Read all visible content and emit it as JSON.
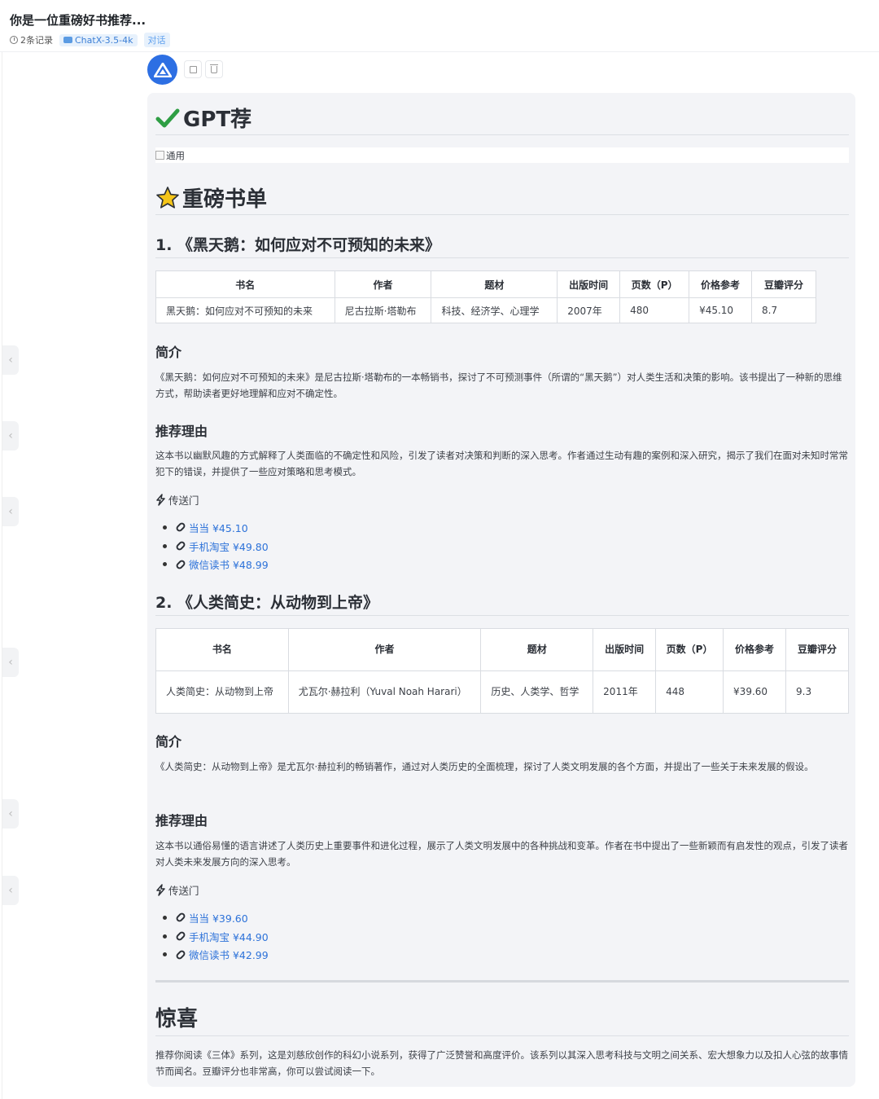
{
  "header": {
    "title": "你是一位重磅好书推荐...",
    "records": "2条记录",
    "model": "ChatX-3.5-4k",
    "type": "对话"
  },
  "message": {
    "heading_gpt": "GPT荐",
    "banner_alt": "通用",
    "heading_list": "重磅书单",
    "books": [
      {
        "title": "1. 《黑天鹅：如何应对不可预知的未来》",
        "table_headers": [
          "书名",
          "作者",
          "题材",
          "出版时间",
          "页数（P）",
          "价格参考",
          "豆瓣评分"
        ],
        "table_row": [
          "黑天鹅：如何应对不可预知的未来",
          "尼古拉斯·塔勒布",
          "科技、经济学、心理学",
          "2007年",
          "480",
          "¥45.10",
          "8.7"
        ],
        "intro_heading": "简介",
        "intro": "《黑天鹅：如何应对不可预知的未来》是尼古拉斯·塔勒布的一本畅销书，探讨了不可预测事件（所谓的“黑天鹅”）对人类生活和决策的影响。该书提出了一种新的思维方式，帮助读者更好地理解和应对不确定性。",
        "reason_heading": "推荐理由",
        "reason": "这本书以幽默风趣的方式解释了人类面临的不确定性和风险，引发了读者对决策和判断的深入思考。作者通过生动有趣的案例和深入研究，揭示了我们在面对未知时常常犯下的错误，并提供了一些应对策略和思考模式。",
        "portal": "传送门",
        "links": [
          "当当 ¥45.10",
          "手机淘宝 ¥49.80",
          "微信读书 ¥48.99"
        ]
      },
      {
        "title": "2. 《人类简史：从动物到上帝》",
        "table_headers": [
          "书名",
          "作者",
          "题材",
          "出版时间",
          "页数（P）",
          "价格参考",
          "豆瓣评分"
        ],
        "table_row": [
          "人类简史：从动物到上帝",
          "尤瓦尔·赫拉利（Yuval Noah Harari）",
          "历史、人类学、哲学",
          "2011年",
          "448",
          "¥39.60",
          "9.3"
        ],
        "intro_heading": "简介",
        "intro": "《人类简史：从动物到上帝》是尤瓦尔·赫拉利的畅销著作，通过对人类历史的全面梳理，探讨了人类文明发展的各个方面，并提出了一些关于未来发展的假设。",
        "reason_heading": "推荐理由",
        "reason": "这本书以通俗易懂的语言讲述了人类历史上重要事件和进化过程，展示了人类文明发展中的各种挑战和变革。作者在书中提出了一些新颖而有启发性的观点，引发了读者对人类未来发展方向的深入思考。",
        "portal": "传送门",
        "links": [
          "当当 ¥39.60",
          "手机淘宝 ¥44.90",
          "微信读书 ¥42.99"
        ]
      }
    ],
    "surprise_heading": "惊喜",
    "surprise": "推荐你阅读《三体》系列，这是刘慈欣创作的科幻小说系列，获得了广泛赞誉和高度评价。该系列以其深入思考科技与文明之间关系、宏大想象力以及扣人心弦的故事情节而闻名。豆瓣评分也非常高，你可以尝试阅读一下。"
  },
  "colors": {
    "accent": "#2d6fe3",
    "link": "#2d72d9",
    "check_green": "#2e9e44",
    "star_yellow": "#f5c518"
  }
}
